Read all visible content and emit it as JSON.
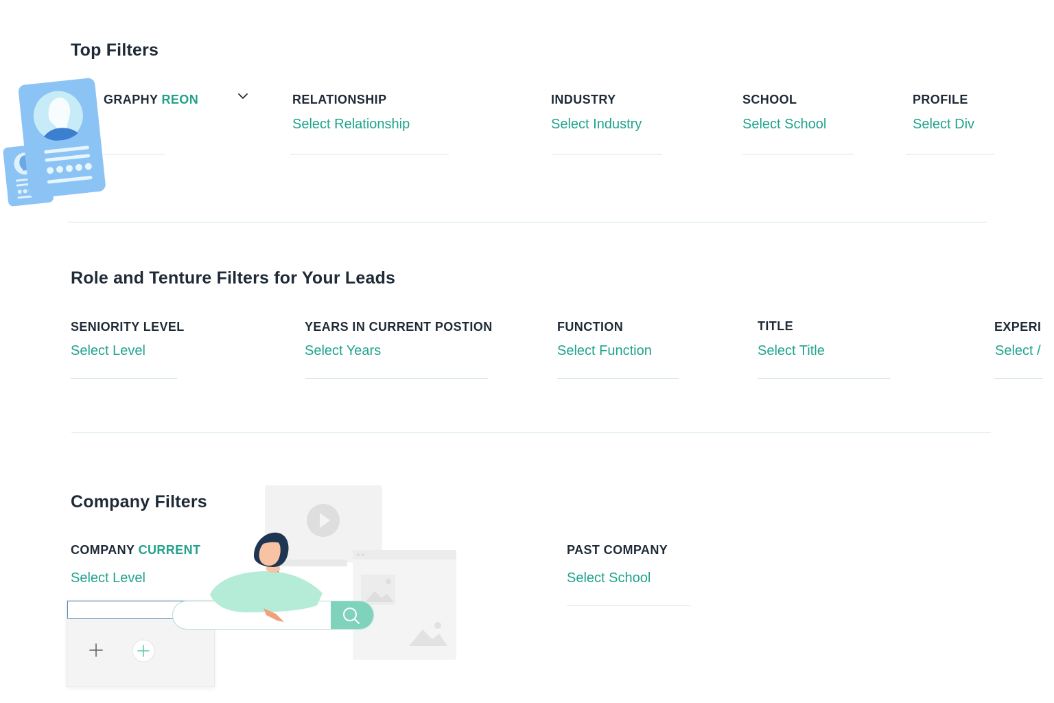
{
  "top_filters": {
    "title": "Top Filters",
    "geography": {
      "label_prefix": "GRAPHY",
      "label_accent": "REON",
      "icon": "chevron-down-icon"
    },
    "relationship": {
      "label": "RELATIONSHIP",
      "value": "Select Relationship"
    },
    "industry": {
      "label": "INDUSTRY",
      "value": "Select Industry"
    },
    "school": {
      "label": "SCHOOL",
      "value": "Select School"
    },
    "profile": {
      "label": "PROFILE",
      "value": "Select Div"
    }
  },
  "role_filters": {
    "title": "Role and Tenture Filters for Your Leads",
    "seniority": {
      "label": "SENIORITY LEVEL",
      "value": "Select Level"
    },
    "years": {
      "label": "YEARS IN CURRENT POSTION",
      "value": "Select Years"
    },
    "function": {
      "label": "FUNCTION",
      "value": "Select Function"
    },
    "title_field": {
      "label": "TITLE",
      "value": "Select Title"
    },
    "experience": {
      "label": "EXPERI",
      "value": "Select /"
    }
  },
  "company_filters": {
    "title": "Company Filters",
    "current": {
      "label_prefix": "COMPANY",
      "label_accent": "CURRENT",
      "value": "Select Level"
    },
    "past": {
      "label": "PAST COMPANY",
      "value": "Select School"
    }
  },
  "colors": {
    "accent": "#1fa38c",
    "text": "#1f2a37",
    "profile_card": "#8cc3f5",
    "search_button": "#7fd3bd"
  },
  "icons": [
    "profile-card-icon",
    "chevron-down-icon",
    "search-icon",
    "play-icon",
    "image-icon",
    "plus-icon",
    "plus-circle-icon"
  ]
}
